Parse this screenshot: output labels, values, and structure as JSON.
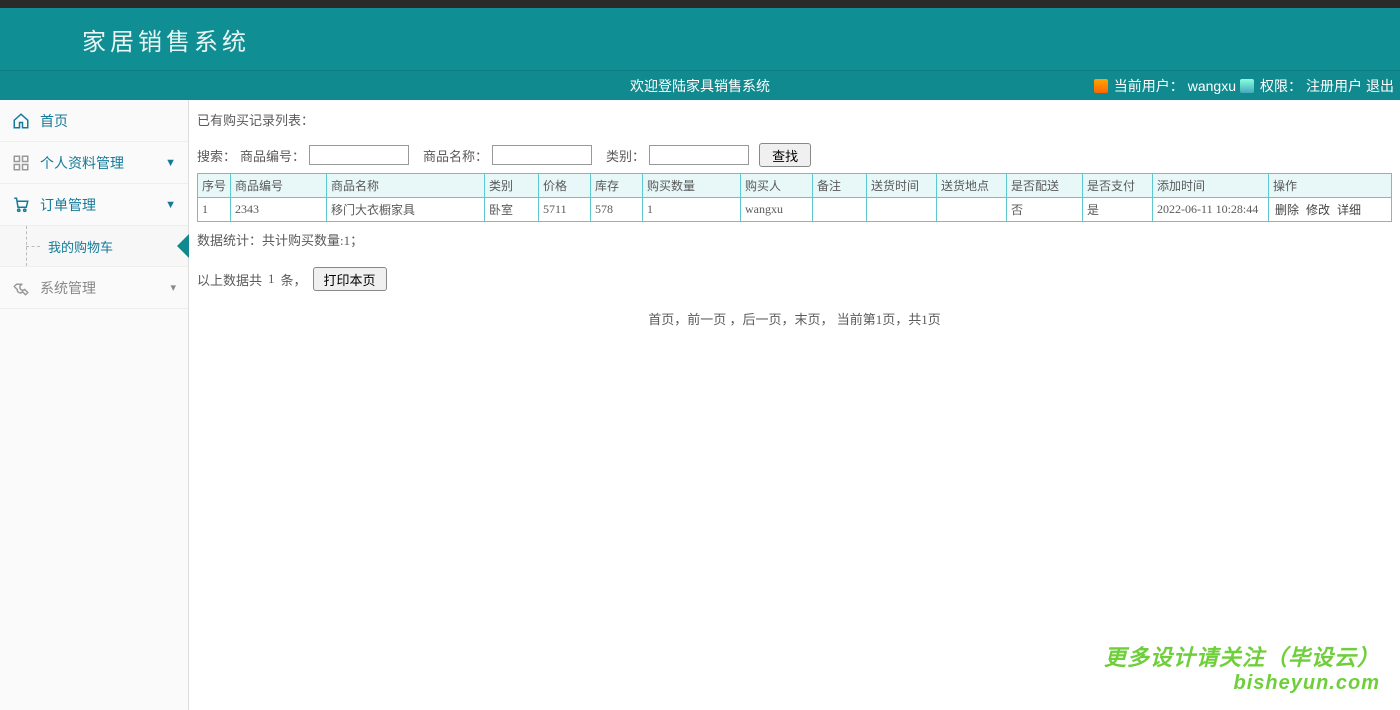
{
  "header": {
    "title": "家居销售系统",
    "welcome": "欢迎登陆家具销售系统",
    "user_label": "当前用户：",
    "user_value": "wangxu",
    "role_label": "权限：",
    "role_value": "注册用户",
    "logout": "退出"
  },
  "sidebar": {
    "home": "首页",
    "profile": "个人资料管理",
    "orders": "订单管理",
    "cart": "我的购物车",
    "system": "系统管理"
  },
  "content": {
    "list_title": "已有购买记录列表：",
    "search_label": "搜索：",
    "product_id_label": "商品编号：",
    "product_name_label": "商品名称：",
    "category_label": "类别：",
    "search_button": "查找",
    "columns": {
      "seq": "序号",
      "product_id": "商品编号",
      "product_name": "商品名称",
      "category": "类别",
      "price": "价格",
      "stock": "库存",
      "qty": "购买数量",
      "buyer": "购买人",
      "remark": "备注",
      "ship_time": "送货时间",
      "ship_addr": "送货地点",
      "delivered": "是否配送",
      "paid": "是否支付",
      "add_time": "添加时间",
      "actions": "操作"
    },
    "rows": [
      {
        "seq": "1",
        "product_id": "2343",
        "product_name": "移门大衣橱家具",
        "category": "卧室",
        "price": "5711",
        "stock": "578",
        "qty": "1",
        "buyer": "wangxu",
        "remark": "",
        "ship_time": "",
        "ship_addr": "",
        "delivered": "否",
        "paid": "是",
        "add_time": "2022-06-11 10:28:44"
      }
    ],
    "actions": {
      "delete": "删除",
      "edit": "修改",
      "detail": "详细"
    },
    "stats": "数据统计：共计购买数量:1；",
    "total_prefix": "以上数据共",
    "total_count": "1",
    "total_suffix": "条，",
    "print_button": "打印本页",
    "pagination": "首页，前一页 ，后一页，末页，  当前第1页，共1页"
  },
  "watermark": {
    "line1": "更多设计请关注（毕设云）",
    "line2": "bisheyun.com"
  }
}
